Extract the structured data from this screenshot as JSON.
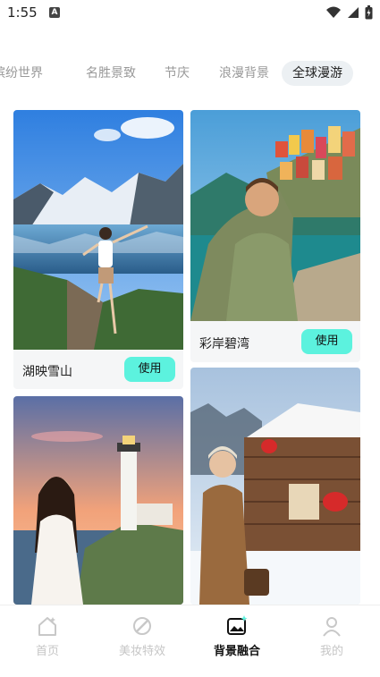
{
  "status_bar": {
    "time": "1:55",
    "notification_glyph": "A"
  },
  "tabs": [
    {
      "label": "缤纷世界",
      "active": false
    },
    {
      "label": "名胜景致",
      "active": false
    },
    {
      "label": "节庆",
      "active": false
    },
    {
      "label": "浪漫背景",
      "active": false
    },
    {
      "label": "全球漫游",
      "active": true
    }
  ],
  "cards": [
    {
      "title": "湖映雪山",
      "use_label": "使用"
    },
    {
      "title": "彩岸碧湾",
      "use_label": "使用"
    }
  ],
  "bottom_nav": [
    {
      "label": "首页",
      "icon": "home-icon",
      "active": false
    },
    {
      "label": "美妆特效",
      "icon": "makeup-brush-icon",
      "active": false
    },
    {
      "label": "背景融合",
      "icon": "image-sparkle-icon",
      "active": true
    },
    {
      "label": "我的",
      "icon": "user-icon",
      "active": false
    }
  ],
  "colors": {
    "accent": "#5cf2de",
    "active_tab_bg": "#ecf0f3",
    "inactive_text": "#999999"
  }
}
